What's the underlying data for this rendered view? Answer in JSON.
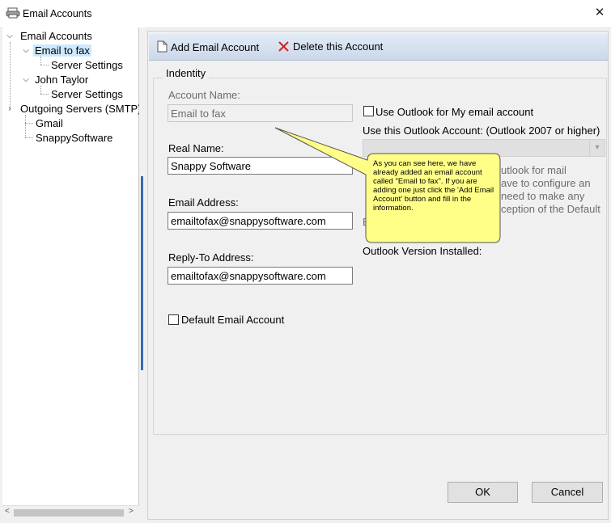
{
  "window": {
    "title": "Email Accounts",
    "close_glyph": "✕"
  },
  "tree": {
    "root": "Email Accounts",
    "accounts": [
      {
        "name": "Email to fax",
        "child": "Server Settings",
        "selected": true
      },
      {
        "name": "John Taylor",
        "child": "Server Settings",
        "selected": false
      }
    ],
    "outgoing": "Outgoing Servers (SMTP)",
    "outgoing_children": [
      "Gmail",
      "SnappySoftware"
    ]
  },
  "toolbar": {
    "add_label": "Add Email Account",
    "delete_label": "Delete this Account"
  },
  "form": {
    "group_label": "Indentity",
    "account_name_label": "Account Name:",
    "account_name_value": "Email to fax",
    "real_name_label": "Real Name:",
    "real_name_value": "Snappy Software",
    "email_label": "Email Address:",
    "email_value": "emailtofax@snappysoftware.com",
    "reply_label": "Reply-To Address:",
    "reply_value": "emailtofax@snappysoftware.com",
    "default_label": "Default Email Account",
    "use_outlook_label": "Use Outlook for My email account",
    "outlook_account_label": "Use this Outlook Account: (Outlook 2007 or higher)",
    "hidden_line1": "utlook for mail",
    "hidden_line2": "ave to configure an",
    "hidden_line3": "need to make any",
    "hidden_line4": "ception of the Default",
    "hidden_line5": "E",
    "outlook_version_label": "Outlook Version Installed:"
  },
  "tooltip": {
    "text": "As you can see here, we have already added an email account called \"Email to fax\".  If you are adding one just click the 'Add Email Account' button and fill in the information."
  },
  "buttons": {
    "ok": "OK",
    "cancel": "Cancel"
  },
  "colors": {
    "selection": "#cde8ff",
    "tooltip": "#ffff88",
    "delete_icon": "#d42020"
  }
}
